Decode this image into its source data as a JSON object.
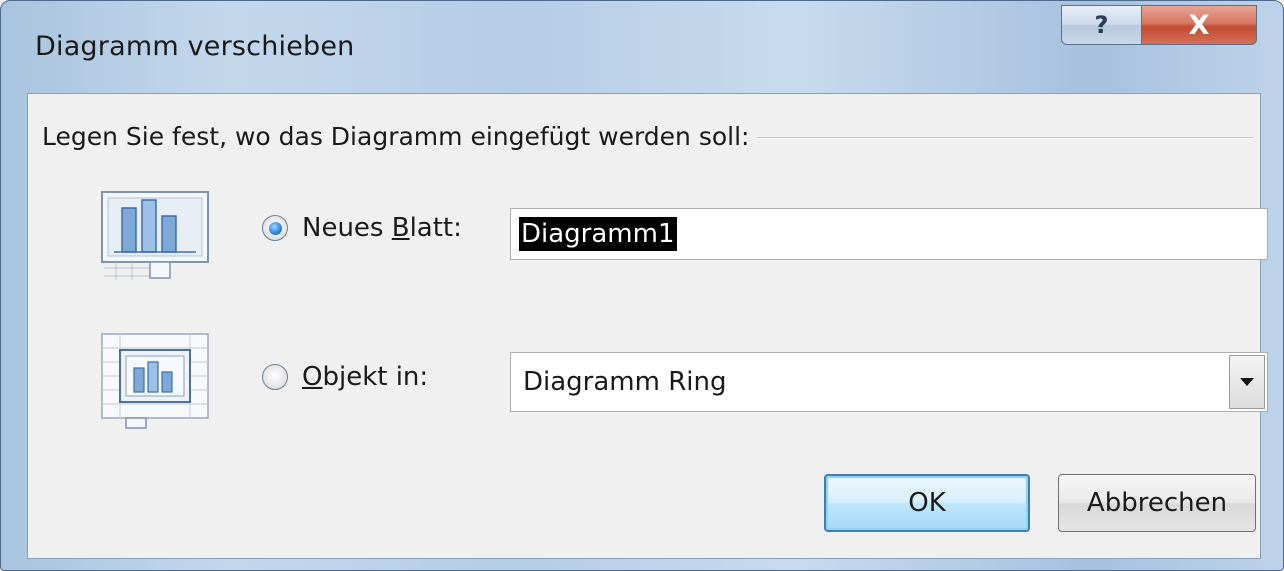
{
  "window": {
    "title": "Diagramm verschieben",
    "help_label": "?",
    "close_label": "X"
  },
  "dialog": {
    "prompt": "Legen Sie fest, wo das Diagramm eingefügt werden soll:",
    "new_sheet": {
      "label_prefix": "Neues ",
      "label_accel": "B",
      "label_suffix": "latt:",
      "selected": true,
      "value": "Diagramm1"
    },
    "object_in": {
      "label_accel": "O",
      "label_suffix": "bjekt in:",
      "selected": false,
      "value": "Diagramm Ring"
    },
    "ok_label": "OK",
    "cancel_label": "Abbrechen"
  },
  "icons": {
    "new_sheet": "chart-sheet-icon",
    "object_in": "embedded-chart-icon"
  },
  "colors": {
    "close_button": "#c24a30",
    "radio_selected": "#2f8ce0",
    "ok_focus": "#3c7fb1"
  }
}
